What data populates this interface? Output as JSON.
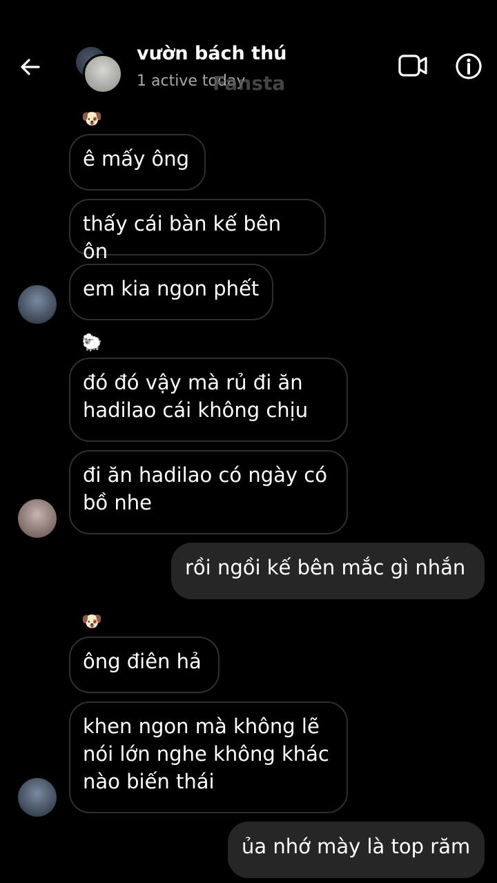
{
  "header": {
    "back_icon": "arrow-left-icon",
    "title": "vườn bách thú",
    "subtitle": "1 active today",
    "watermark": "Fansta",
    "video_icon": "video-camera-icon",
    "info_icon": "info-icon"
  },
  "messages": [
    {
      "reaction": "🐶"
    },
    {
      "text": "ê mấy ông"
    },
    {
      "text": "thấy cái bàn kế bên ôn"
    },
    {
      "text": "em kia ngon phết"
    },
    {
      "reaction": "🐑"
    },
    {
      "text": "đó đó vậy mà rủ đi ăn hadilao cái không chịu"
    },
    {
      "text": "đi ăn hadilao có ngày có bồ nhe"
    },
    {
      "text": "rồi ngồi kế bên mắc gì nhắn"
    },
    {
      "reaction": "🐶"
    },
    {
      "text": "ông điên hả"
    },
    {
      "text": "khen ngon mà không lẽ nói lớn nghe không khác nào biến thái"
    },
    {
      "text": "ủa nhớ mày là top răm"
    }
  ]
}
